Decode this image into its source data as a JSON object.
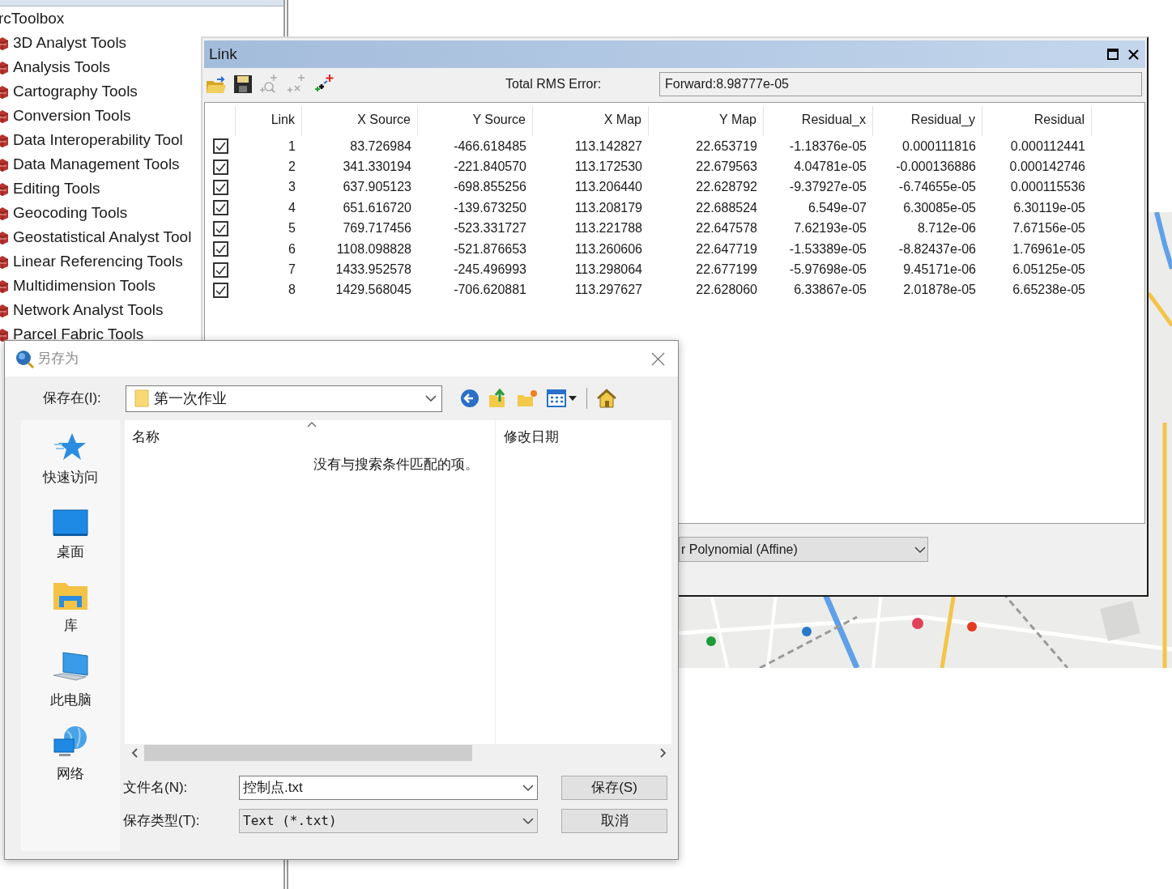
{
  "toolbox": {
    "title": "rcToolbox",
    "items": [
      "3D Analyst Tools",
      "Analysis Tools",
      "Cartography Tools",
      "Conversion Tools",
      "Data Interoperability Tool",
      "Data Management Tools",
      "Editing Tools",
      "Geocoding Tools",
      "Geostatistical Analyst Tool",
      "Linear Referencing Tools",
      "Multidimension Tools",
      "Network Analyst Tools",
      "Parcel Fabric Tools"
    ]
  },
  "link_window": {
    "title": "Link",
    "rms_label": "Total RMS Error:",
    "rms_value": "Forward:8.98777e-05",
    "columns": [
      "Link",
      "X Source",
      "Y Source",
      "X Map",
      "Y Map",
      "Residual_x",
      "Residual_y",
      "Residual"
    ],
    "rows": [
      {
        "checked": true,
        "cells": [
          "1",
          "83.726984",
          "-466.618485",
          "113.142827",
          "22.653719",
          "-1.18376e-05",
          "0.000111816",
          "0.000112441"
        ]
      },
      {
        "checked": true,
        "cells": [
          "2",
          "341.330194",
          "-221.840570",
          "113.172530",
          "22.679563",
          "4.04781e-05",
          "-0.000136886",
          "0.000142746"
        ]
      },
      {
        "checked": true,
        "cells": [
          "3",
          "637.905123",
          "-698.855256",
          "113.206440",
          "22.628792",
          "-9.37927e-05",
          "-6.74655e-05",
          "0.000115536"
        ]
      },
      {
        "checked": true,
        "cells": [
          "4",
          "651.616720",
          "-139.673250",
          "113.208179",
          "22.688524",
          "6.549e-07",
          "6.30085e-05",
          "6.30119e-05"
        ]
      },
      {
        "checked": true,
        "cells": [
          "5",
          "769.717456",
          "-523.331727",
          "113.221788",
          "22.647578",
          "7.62193e-05",
          "8.712e-06",
          "7.67156e-05"
        ]
      },
      {
        "checked": true,
        "cells": [
          "6",
          "1108.098828",
          "-521.876653",
          "113.260606",
          "22.647719",
          "-1.53389e-05",
          "-8.82437e-06",
          "1.76961e-05"
        ]
      },
      {
        "checked": true,
        "cells": [
          "7",
          "1433.952578",
          "-245.496993",
          "113.298064",
          "22.677199",
          "-5.97698e-05",
          "9.45171e-06",
          "6.05125e-05"
        ]
      },
      {
        "checked": true,
        "cells": [
          "8",
          "1429.568045",
          "-706.620881",
          "113.297627",
          "22.628060",
          "6.33867e-05",
          "2.01878e-05",
          "6.65238e-05"
        ]
      }
    ],
    "transformation": "r Polynomial (Affine)"
  },
  "save_dialog": {
    "title": "另存为",
    "save_in_label": "保存在(I):",
    "folder": "第一次作业",
    "places": [
      {
        "kind": "quick",
        "label": "快速访问"
      },
      {
        "kind": "desktop",
        "label": "桌面"
      },
      {
        "kind": "library",
        "label": "库"
      },
      {
        "kind": "computer",
        "label": "此电脑"
      },
      {
        "kind": "network",
        "label": "网络"
      }
    ],
    "columns": [
      "名称",
      "修改日期"
    ],
    "empty_message": "没有与搜索条件匹配的项。",
    "file_name_label": "文件名(N):",
    "file_name": "控制点.txt",
    "type_label": "保存类型(T):",
    "file_type": "Text (*.txt)",
    "buttons": [
      "保存(S)",
      "取消"
    ]
  }
}
